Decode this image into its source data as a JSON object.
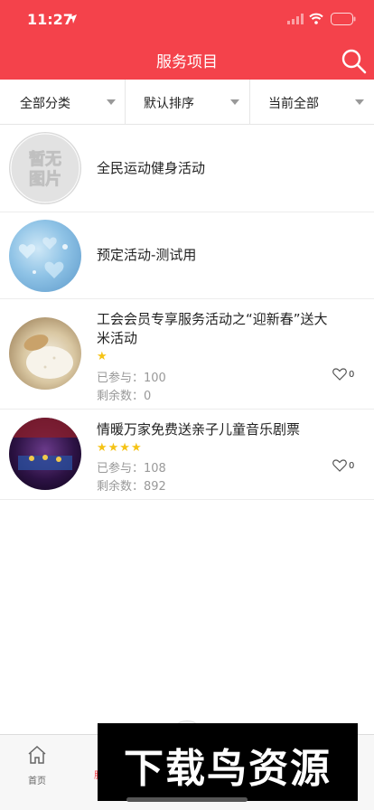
{
  "status_bar": {
    "time": "11:27"
  },
  "header": {
    "title": "服务项目",
    "search_icon": "search-icon"
  },
  "filters": [
    {
      "label": "全部分类"
    },
    {
      "label": "默认排序"
    },
    {
      "label": "当前全部"
    }
  ],
  "placeholder_image_text": "暂无图片",
  "items": [
    {
      "title": "全民运动健身活动",
      "thumbnail": "placeholder"
    },
    {
      "title": "预定活动-测试用",
      "thumbnail": "blue-hearts"
    },
    {
      "title_line1": "工会会员专享服务活动之“迎新春”送大",
      "title_line2": "米活动",
      "stars": "★",
      "rating": 1,
      "joined_label": "已参与：",
      "joined": "100",
      "remaining_label": "剩余数：",
      "remaining": "0",
      "likes": "0",
      "thumbnail": "rice"
    },
    {
      "title": "情暖万家免费送亲子儿童音乐剧票",
      "stars": "★★★★",
      "rating": 4,
      "joined_label": "已参与：",
      "joined": "108",
      "remaining_label": "剩余数：",
      "remaining": "892",
      "likes": "0",
      "thumbnail": "stage"
    }
  ],
  "tabbar": {
    "home_label": "首页",
    "second_label_partial": "服"
  },
  "watermark": {
    "text": "下载鸟资源"
  },
  "colors": {
    "primary": "#f4424b",
    "star": "#f5c315",
    "muted": "#999999"
  }
}
